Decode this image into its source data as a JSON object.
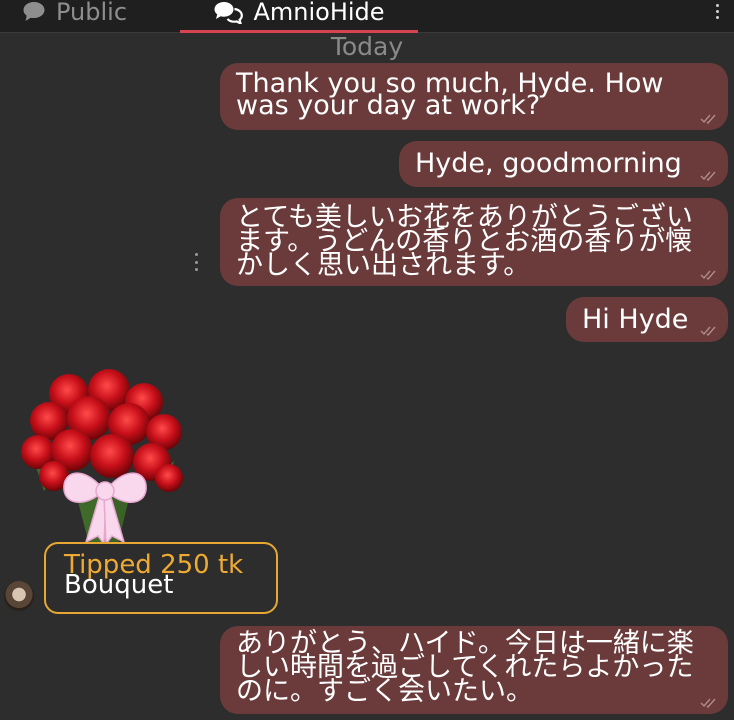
{
  "tabs": [
    {
      "label": "Public",
      "icon": "chat-bubble-icon"
    },
    {
      "label": "AmnioHide",
      "icon": "private-chat-icon"
    }
  ],
  "date_separator": "Today",
  "messages": [
    {
      "text": "Thank you so much, Hyde. How was your day at work?"
    },
    {
      "text": "Hyde, goodmorning"
    },
    {
      "text": "とても美しいお花をありがとうございます。うどんの香りとお酒の香りが懐かしく思い出されます。"
    },
    {
      "text": "Hi Hyde"
    },
    {
      "text": "ありがとう、ハイド。今日は一緒に楽しい時間を過ごしてくれたらよかったのに。すごく会いたい。"
    }
  ],
  "tip": {
    "amount": "Tipped 250 tk",
    "item": "Bouquet"
  },
  "colors": {
    "bubble": "#6b3b3b",
    "accent": "#d6454f",
    "tip": "#eeaa33"
  }
}
